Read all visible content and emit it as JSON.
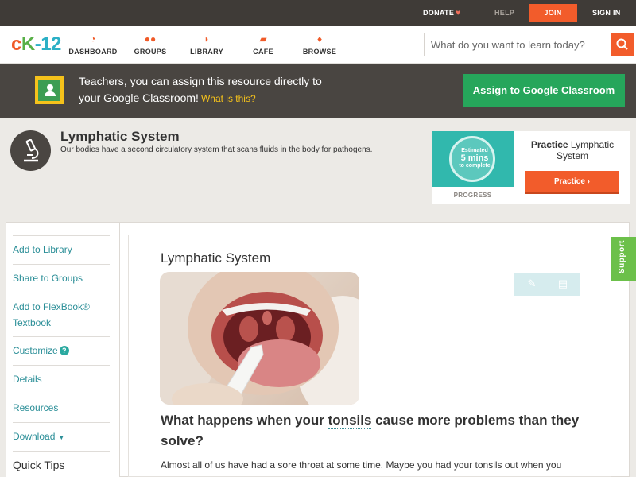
{
  "topbar": {
    "donate": "DONATE",
    "help": "HELP",
    "join": "JOIN",
    "signin": "SIGN IN"
  },
  "logo": {
    "c": "c",
    "k": "K",
    "n": "-12"
  },
  "nav": {
    "items": [
      {
        "label": "DASHBOARD",
        "icon": "dashboard-icon"
      },
      {
        "label": "GROUPS",
        "icon": "groups-icon"
      },
      {
        "label": "LIBRARY",
        "icon": "library-icon"
      },
      {
        "label": "CAFE",
        "icon": "cafe-icon"
      },
      {
        "label": "BROWSE",
        "icon": "browse-icon"
      }
    ],
    "search_placeholder": "What do you want to learn today?"
  },
  "banner": {
    "line1": "Teachers, you can assign this resource directly to",
    "line2": "your Google Classroom!",
    "what": "What is this?",
    "assign": "Assign to Google Classroom"
  },
  "header": {
    "title": "Lymphatic System",
    "subtitle": "Our bodies have a second circulatory system that scans fluids in the body for pathogens."
  },
  "practice": {
    "estimated": "Estimated",
    "mins": "5 mins",
    "complete": "to complete",
    "progress": "PROGRESS",
    "practice_word": "Practice",
    "practice_topic": "Lymphatic System",
    "button": "Practice"
  },
  "sidebar": {
    "items": [
      "Add to Library",
      "Share to Groups",
      "Add to FlexBook® Textbook",
      "Customize",
      "Details",
      "Resources",
      "Download"
    ],
    "quick_tips": "Quick Tips"
  },
  "article": {
    "title": "Lymphatic System",
    "question_pre": "What happens when your",
    "question_vocab": "tonsils",
    "question_post": "cause more problems than they solve?",
    "paragraph": "Almost all of us have had a sore throat at some time. Maybe you had your tonsils out when you"
  },
  "support": "Support",
  "colors": {
    "accent_orange": "#f25c2b",
    "google_green": "#26a65b",
    "teal_link": "#2a8e97",
    "support_green": "#6cc04a"
  }
}
